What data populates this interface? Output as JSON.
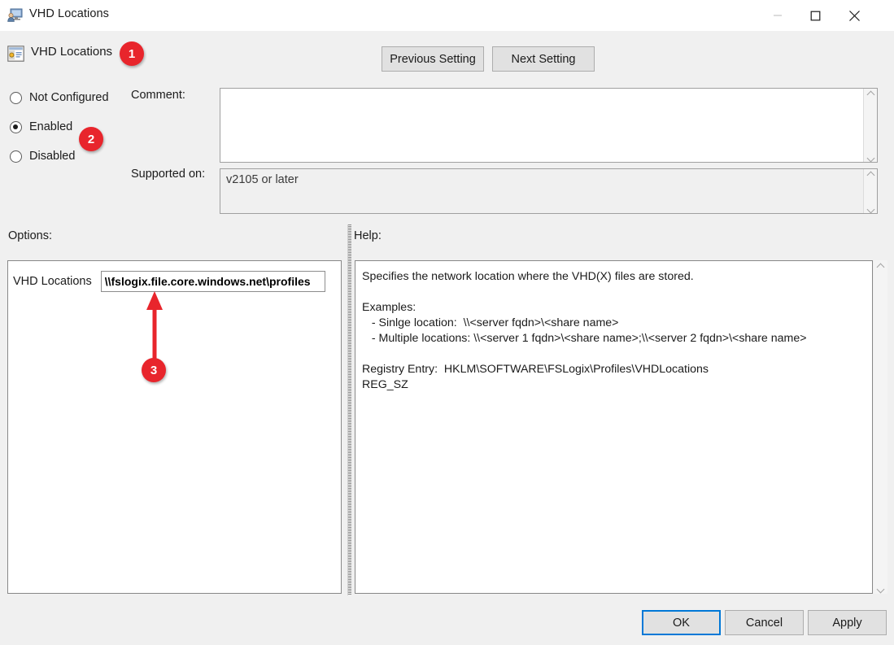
{
  "window": {
    "title": "VHD Locations",
    "icon": "computer-user-icon",
    "controls": {
      "minimize": "minimize-icon",
      "maximize": "maximize-icon",
      "close": "close-icon"
    }
  },
  "header": {
    "icon": "group-policy-setting-icon",
    "title": "VHD Locations",
    "previous_setting": "Previous Setting",
    "next_setting": "Next Setting"
  },
  "state": {
    "options": [
      "Not Configured",
      "Enabled",
      "Disabled"
    ],
    "selected": "Enabled"
  },
  "comment": {
    "label": "Comment:",
    "value": ""
  },
  "supported": {
    "label": "Supported on:",
    "value": "v2105 or later"
  },
  "options_panel": {
    "label": "Options:",
    "vhd_locations_label": "VHD Locations",
    "vhd_locations_value": "\\\\fslogix.file.core.windows.net\\profiles",
    "vhd_locations_placeholder": ""
  },
  "help_panel": {
    "label": "Help:",
    "text": "Specifies the network location where the VHD(X) files are stored.\n\nExamples:\n   - Sinlge location:  \\\\<server fqdn>\\<share name>\n   - Multiple locations: \\\\<server 1 fqdn>\\<share name>;\\\\<server 2 fqdn>\\<share name>\n\nRegistry Entry:  HKLM\\SOFTWARE\\FSLogix\\Profiles\\VHDLocations\nREG_SZ"
  },
  "footer": {
    "ok": "OK",
    "cancel": "Cancel",
    "apply": "Apply"
  },
  "annotations": {
    "badge_1": "1",
    "badge_2": "2",
    "badge_3": "3",
    "color": "#e8252c"
  }
}
